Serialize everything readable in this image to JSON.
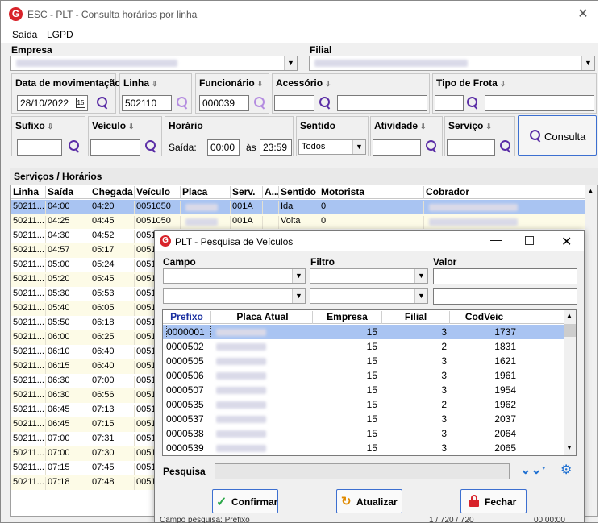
{
  "window": {
    "title": "ESC - PLT - Consulta horários por linha",
    "logo": "G"
  },
  "menu": [
    "Saída",
    "LGPD"
  ],
  "labels": {
    "empresa": "Empresa",
    "filial": "Filial",
    "data_mov": "Data de movimentação",
    "linha": "Linha",
    "funcionario": "Funcionário",
    "acessorio": "Acessório",
    "tipo_frota": "Tipo de Frota",
    "sufixo": "Sufixo",
    "veiculo": "Veículo",
    "horario": "Horário",
    "sentido": "Sentido",
    "atividade": "Atividade",
    "servico": "Serviço",
    "saida": "Saída:",
    "as": "às",
    "consulta": "Consulta",
    "section": "Serviços / Horários"
  },
  "values": {
    "data_mov": "28/10/2022",
    "linha": "502110",
    "funcionario": "000039",
    "saida_inicio": "00:00",
    "saida_fim": "23:59",
    "sentido": "Todos"
  },
  "grid": {
    "columns": [
      "Linha",
      "Saída",
      "Chegada",
      "Veículo",
      "Placa",
      "Serv.",
      "A...",
      "Sentido",
      "Motorista",
      "Cobrador"
    ],
    "rows": [
      {
        "linha": "50211...",
        "saida": "04:00",
        "chegada": "04:20",
        "veiculo": "0051050",
        "serv": "001A",
        "sentido": "Ida",
        "motorista": "0"
      },
      {
        "linha": "50211...",
        "saida": "04:25",
        "chegada": "04:45",
        "veiculo": "0051050",
        "serv": "001A",
        "sentido": "Volta",
        "motorista": "0"
      },
      {
        "linha": "50211...",
        "saida": "04:30",
        "chegada": "04:52",
        "veiculo": "0051",
        "serv": "",
        "sentido": "",
        "motorista": ""
      },
      {
        "linha": "50211...",
        "saida": "04:57",
        "chegada": "05:17",
        "veiculo": "0051",
        "serv": "",
        "sentido": "",
        "motorista": ""
      },
      {
        "linha": "50211...",
        "saida": "05:00",
        "chegada": "05:24",
        "veiculo": "0051",
        "serv": "",
        "sentido": "",
        "motorista": ""
      },
      {
        "linha": "50211...",
        "saida": "05:20",
        "chegada": "05:45",
        "veiculo": "0051",
        "serv": "",
        "sentido": "",
        "motorista": ""
      },
      {
        "linha": "50211...",
        "saida": "05:30",
        "chegada": "05:53",
        "veiculo": "0051",
        "serv": "",
        "sentido": "",
        "motorista": ""
      },
      {
        "linha": "50211...",
        "saida": "05:40",
        "chegada": "06:05",
        "veiculo": "0051",
        "serv": "",
        "sentido": "",
        "motorista": ""
      },
      {
        "linha": "50211...",
        "saida": "05:50",
        "chegada": "06:18",
        "veiculo": "0051",
        "serv": "",
        "sentido": "",
        "motorista": ""
      },
      {
        "linha": "50211...",
        "saida": "06:00",
        "chegada": "06:25",
        "veiculo": "0051",
        "serv": "",
        "sentido": "",
        "motorista": ""
      },
      {
        "linha": "50211...",
        "saida": "06:10",
        "chegada": "06:40",
        "veiculo": "0051",
        "serv": "",
        "sentido": "",
        "motorista": ""
      },
      {
        "linha": "50211...",
        "saida": "06:15",
        "chegada": "06:40",
        "veiculo": "0051",
        "serv": "",
        "sentido": "",
        "motorista": ""
      },
      {
        "linha": "50211...",
        "saida": "06:30",
        "chegada": "07:00",
        "veiculo": "0051",
        "serv": "",
        "sentido": "",
        "motorista": ""
      },
      {
        "linha": "50211...",
        "saida": "06:30",
        "chegada": "06:56",
        "veiculo": "0051",
        "serv": "",
        "sentido": "",
        "motorista": ""
      },
      {
        "linha": "50211...",
        "saida": "06:45",
        "chegada": "07:13",
        "veiculo": "0051",
        "serv": "",
        "sentido": "",
        "motorista": ""
      },
      {
        "linha": "50211...",
        "saida": "06:45",
        "chegada": "07:15",
        "veiculo": "0051",
        "serv": "",
        "sentido": "",
        "motorista": ""
      },
      {
        "linha": "50211...",
        "saida": "07:00",
        "chegada": "07:31",
        "veiculo": "0051",
        "serv": "",
        "sentido": "",
        "motorista": ""
      },
      {
        "linha": "50211...",
        "saida": "07:00",
        "chegada": "07:30",
        "veiculo": "0051",
        "serv": "",
        "sentido": "",
        "motorista": ""
      },
      {
        "linha": "50211...",
        "saida": "07:15",
        "chegada": "07:45",
        "veiculo": "0051",
        "serv": "",
        "sentido": "",
        "motorista": ""
      },
      {
        "linha": "50211...",
        "saida": "07:18",
        "chegada": "07:48",
        "veiculo": "0051",
        "serv": "",
        "sentido": "",
        "motorista": ""
      }
    ]
  },
  "dialog": {
    "title": "PLT - Pesquisa de Veículos",
    "logo": "G",
    "campo": "Campo",
    "filtro": "Filtro",
    "valor": "Valor",
    "columns": [
      "Prefixo",
      "Placa Atual",
      "Empresa",
      "Filial",
      "CodVeic"
    ],
    "rows": [
      {
        "prefixo": "0000001",
        "empresa": "15",
        "filial": "3",
        "codveic": "1737"
      },
      {
        "prefixo": "0000502",
        "empresa": "15",
        "filial": "2",
        "codveic": "1831"
      },
      {
        "prefixo": "0000505",
        "empresa": "15",
        "filial": "3",
        "codveic": "1621"
      },
      {
        "prefixo": "0000506",
        "empresa": "15",
        "filial": "3",
        "codveic": "1961"
      },
      {
        "prefixo": "0000507",
        "empresa": "15",
        "filial": "3",
        "codveic": "1954"
      },
      {
        "prefixo": "0000535",
        "empresa": "15",
        "filial": "2",
        "codveic": "1962"
      },
      {
        "prefixo": "0000537",
        "empresa": "15",
        "filial": "3",
        "codveic": "2037"
      },
      {
        "prefixo": "0000538",
        "empresa": "15",
        "filial": "3",
        "codveic": "2064"
      },
      {
        "prefixo": "0000539",
        "empresa": "15",
        "filial": "3",
        "codveic": "2065"
      }
    ],
    "pesquisa": "Pesquisa",
    "buttons": {
      "confirmar": "Confirmar",
      "atualizar": "Atualizar",
      "fechar": "Fechar"
    },
    "status_left": "Campo pesquisa: Prefixo",
    "status_count": "1 / 720 / 720",
    "status_time": "00:00:00"
  },
  "colors": {
    "accent": "#3c6fd0",
    "selected_row": "#a9c4f2",
    "odd_row": "#fdfbe7",
    "logo": "#d8232a",
    "search_icon": "#5b2ea6"
  }
}
